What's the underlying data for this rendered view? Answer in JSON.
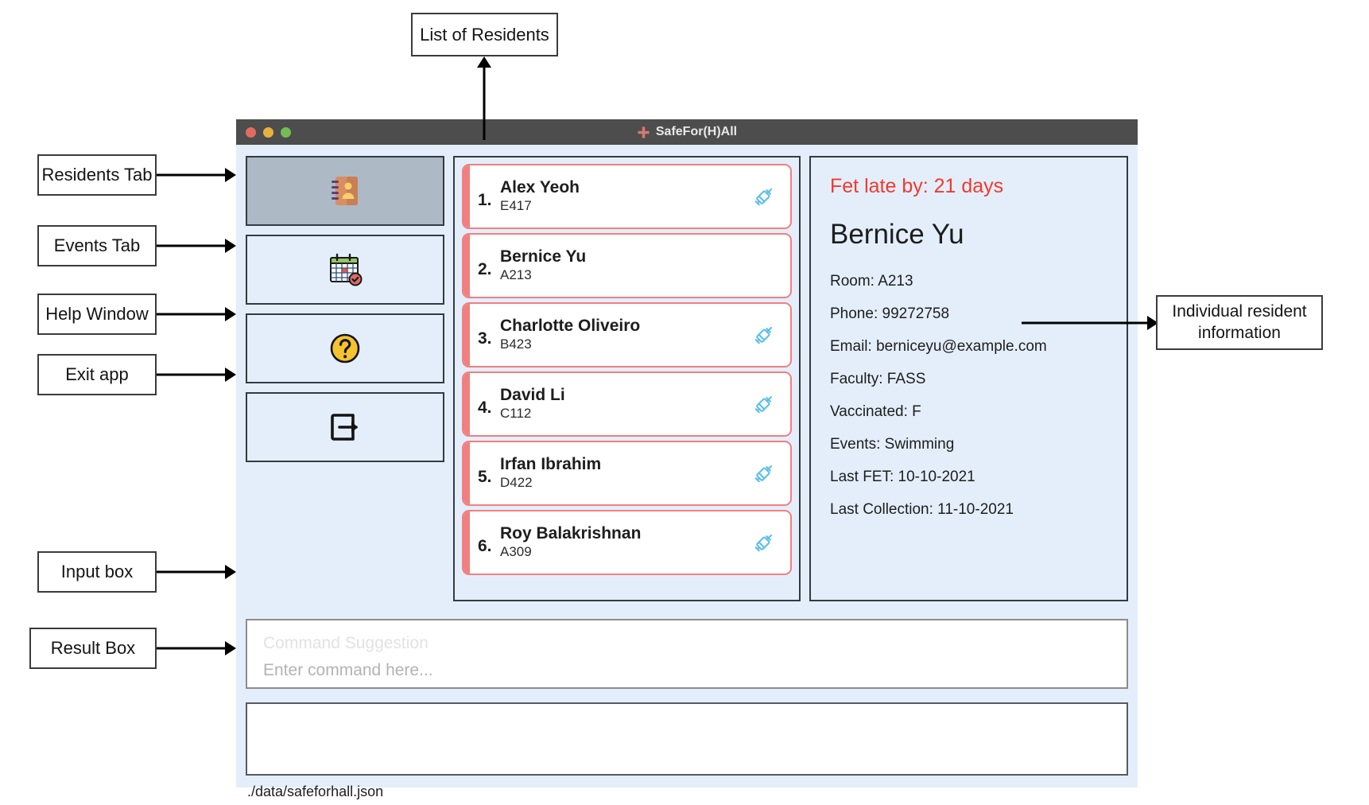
{
  "window": {
    "title": "SafeFor(H)All",
    "title_icon": "medical-cross-icon",
    "traffic_lights": [
      "close-red",
      "minimize-amber",
      "maximize-green"
    ],
    "colors": {
      "titlebar": "#4d4d4d",
      "app_background": "#e4eefb",
      "accent_red": "#f08080",
      "alert_red": "#ef3a2d",
      "selected_tab": "#adb9c4",
      "syringe_blue": "#5bc0e8"
    }
  },
  "sidebar": {
    "items": [
      {
        "name": "residents-tab",
        "icon": "address-book-icon",
        "selected": true
      },
      {
        "name": "events-tab",
        "icon": "calendar-check-icon",
        "selected": false
      },
      {
        "name": "help-tab",
        "icon": "question-mark-circle-icon",
        "selected": false
      },
      {
        "name": "exit-tab",
        "icon": "exit-door-arrow-icon",
        "selected": false
      }
    ]
  },
  "resident_list": {
    "items": [
      {
        "index": "1.",
        "name": "Alex Yeoh",
        "room": "E417",
        "syringe": true
      },
      {
        "index": "2.",
        "name": "Bernice Yu",
        "room": "A213",
        "syringe": false
      },
      {
        "index": "3.",
        "name": "Charlotte Oliveiro",
        "room": "B423",
        "syringe": true
      },
      {
        "index": "4.",
        "name": "David Li",
        "room": "C112",
        "syringe": true
      },
      {
        "index": "5.",
        "name": "Irfan Ibrahim",
        "room": "D422",
        "syringe": true
      },
      {
        "index": "6.",
        "name": "Roy Balakrishnan",
        "room": "A309",
        "syringe": true
      }
    ]
  },
  "detail": {
    "fet_late": "Fet late by: 21 days",
    "name": "Bernice Yu",
    "fields": [
      "Room: A213",
      "Phone: 99272758",
      "Email: berniceyu@example.com",
      "Faculty: FASS",
      "Vaccinated: F",
      "Events: Swimming",
      "Last FET: 10-10-2021",
      "Last Collection: 11-10-2021"
    ]
  },
  "command": {
    "suggestion": "Command Suggestion",
    "placeholder": "Enter command here...",
    "value": ""
  },
  "result": {
    "text": ""
  },
  "status_bar": {
    "file_path": "./data/safeforhall.json"
  },
  "annotations": {
    "list_of_residents": "List of Residents",
    "residents_tab": "Residents Tab",
    "events_tab": "Events Tab",
    "help_window": "Help Window",
    "exit_app": "Exit app",
    "input_box": "Input box",
    "result_box": "Result Box",
    "individual_resident_information": "Individual resident information"
  }
}
